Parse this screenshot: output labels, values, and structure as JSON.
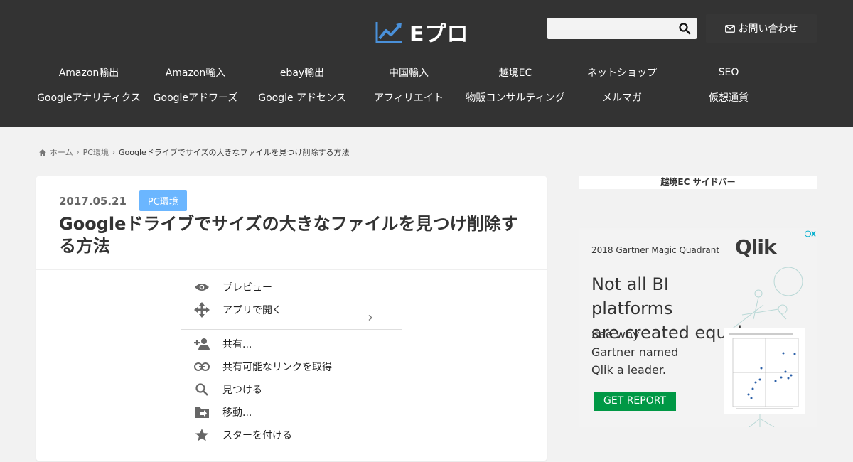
{
  "header": {
    "logo_text": "Eプロ",
    "search": {
      "placeholder": ""
    },
    "contact_label": "お問い合わせ"
  },
  "nav": {
    "row1": [
      "Amazon輸出",
      "Amazon輸入",
      "ebay輸出",
      "中国輸入",
      "越境EC",
      "ネットショップ",
      "SEO"
    ],
    "row2": [
      "Googleアナリティクス",
      "Googleアドワーズ",
      "Google アドセンス",
      "アフィリエイト",
      "物販コンサルティング",
      "メルマガ",
      "仮想通貨"
    ]
  },
  "breadcrumb": {
    "home": "ホーム",
    "category": "PC環境",
    "current": "Googleドライブでサイズの大きなファイルを見つけ削除する方法"
  },
  "article": {
    "date": "2017.05.21",
    "category": "PC環境",
    "title": "Googleドライブでサイズの大きなファイルを見つけ削除する方法",
    "context_menu": [
      {
        "label": "プレビュー",
        "icon": "eye-icon"
      },
      {
        "label": "アプリで開く",
        "icon": "move-arrows-icon"
      },
      {
        "label": "共有...",
        "icon": "person-add-icon"
      },
      {
        "label": "共有可能なリンクを取得",
        "icon": "link-icon"
      },
      {
        "label": "見つける",
        "icon": "search-icon"
      },
      {
        "label": "移動...",
        "icon": "folder-move-icon"
      },
      {
        "label": "スターを付ける",
        "icon": "star-icon"
      }
    ]
  },
  "sidebar": {
    "title": "越境EC サイドバー",
    "ad": {
      "top_line": "2018 Gartner Magic Quadrant",
      "brand": "Qlik",
      "headline_1": "Not all BI platforms",
      "headline_2": "are created equal.",
      "sub_1": "See why",
      "sub_2": "Gartner named",
      "sub_3": "Qlik a leader.",
      "cta": "GET REPORT"
    }
  },
  "colors": {
    "header_bg": "#333333",
    "accent_blue": "#6bb6ff",
    "logo_icon": "#4a90d9",
    "ad_green": "#009845"
  }
}
